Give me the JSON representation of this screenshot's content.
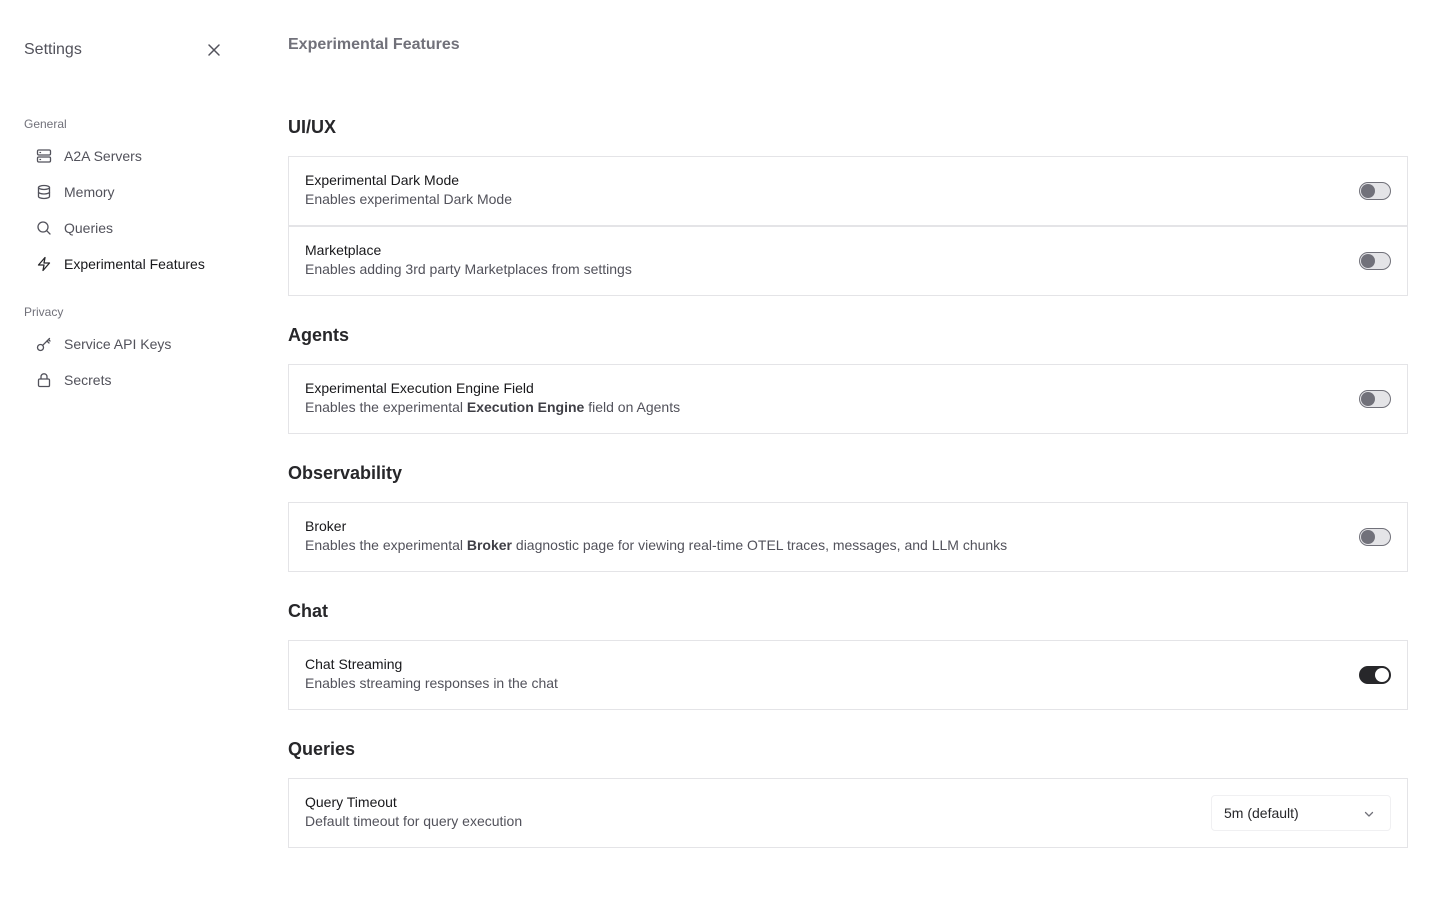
{
  "sidebar": {
    "title": "Settings",
    "close_icon": "close-icon",
    "groups": [
      {
        "label": "General",
        "items": [
          {
            "label": "A2A Servers",
            "icon": "server-icon"
          },
          {
            "label": "Memory",
            "icon": "database-icon"
          },
          {
            "label": "Queries",
            "icon": "search-icon"
          },
          {
            "label": "Experimental Features",
            "icon": "zap-icon",
            "active": true
          }
        ]
      },
      {
        "label": "Privacy",
        "items": [
          {
            "label": "Service API Keys",
            "icon": "key-icon"
          },
          {
            "label": "Secrets",
            "icon": "lock-icon"
          }
        ]
      }
    ]
  },
  "main": {
    "page_title": "Experimental Features",
    "sections": [
      {
        "title": "UI/UX",
        "items": [
          {
            "title": "Experimental Dark Mode",
            "description": "Enables experimental Dark Mode",
            "enabled": false
          },
          {
            "title": "Marketplace",
            "description": "Enables adding 3rd party Marketplaces from settings",
            "enabled": false
          }
        ]
      },
      {
        "title": "Agents",
        "items": [
          {
            "title": "Experimental Execution Engine Field",
            "description_pre": "Enables the experimental ",
            "description_bold": "Execution Engine",
            "description_post": " field on Agents",
            "enabled": false
          }
        ]
      },
      {
        "title": "Observability",
        "items": [
          {
            "title": "Broker",
            "description_pre": "Enables the experimental ",
            "description_bold": "Broker",
            "description_post": " diagnostic page for viewing real-time OTEL traces, messages, and LLM chunks",
            "enabled": false
          }
        ]
      },
      {
        "title": "Chat",
        "items": [
          {
            "title": "Chat Streaming",
            "description": "Enables streaming responses in the chat",
            "enabled": true
          }
        ]
      },
      {
        "title": "Queries",
        "items": [
          {
            "title": "Query Timeout",
            "description": "Default timeout for query execution",
            "select_value": "5m (default)",
            "select_icon": "chevron-down-icon"
          }
        ]
      }
    ]
  },
  "colors": {
    "toggle_on": "#27272a",
    "toggle_off_track": "#e4e4e7",
    "toggle_off_knob": "#71717a",
    "border": "#e4e4e7"
  }
}
